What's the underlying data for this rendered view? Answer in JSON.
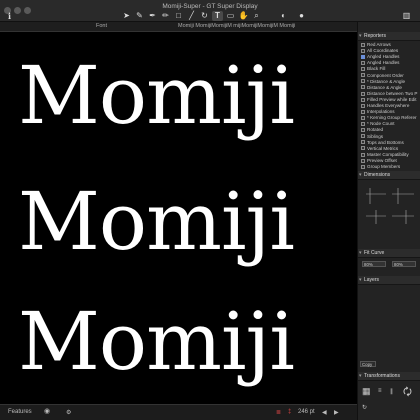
{
  "window": {
    "title": "Momiji-Super - GT Super Display"
  },
  "tabbar": {
    "label": "Font",
    "tab_text": "Momiji MomijiMomijiM mijiMomijiMomijiM Momiji"
  },
  "canvas": {
    "lines": [
      "Momiji",
      "Momiji",
      "Momiji"
    ]
  },
  "statusbar": {
    "features_label": "Features",
    "zoom": "246 pt"
  },
  "sidebar": {
    "reporters_title": "Reporters",
    "reporters": [
      {
        "label": "Red Arrows",
        "checked": false
      },
      {
        "label": "All Coordinates",
        "checked": false
      },
      {
        "label": "Angled Handles",
        "checked": true
      },
      {
        "label": "Angled Handles",
        "checked": false
      },
      {
        "label": "Black Fill",
        "checked": false
      },
      {
        "label": "Component Order",
        "checked": false
      },
      {
        "label": "* Distance & Angle",
        "checked": false
      },
      {
        "label": "Distance & Angle",
        "checked": false
      },
      {
        "label": "Distance between Two P",
        "checked": false
      },
      {
        "label": "Filled Preview while Edit",
        "checked": false
      },
      {
        "label": "Handles Everywhere",
        "checked": false
      },
      {
        "label": "Interpolations",
        "checked": false
      },
      {
        "label": "* Kerning Group Referer",
        "checked": false
      },
      {
        "label": "* Node Count",
        "checked": false
      },
      {
        "label": "Rotated",
        "checked": false
      },
      {
        "label": "Siblings",
        "checked": false
      },
      {
        "label": "Tops and Bottoms",
        "checked": false
      },
      {
        "label": "Vertical Metrics",
        "checked": false
      },
      {
        "label": "Master Compatibility",
        "checked": false
      },
      {
        "label": "Preview Offset",
        "checked": false
      },
      {
        "label": "Group Members",
        "checked": false
      }
    ],
    "dimensions_title": "Dimensions",
    "fit_curve_title": "Fit Curve",
    "fit_left": "80%",
    "fit_right": "80%",
    "layers_title": "Layers",
    "copy_label": "Copy",
    "transformations_title": "Transformations",
    "scale_value": "5%"
  }
}
